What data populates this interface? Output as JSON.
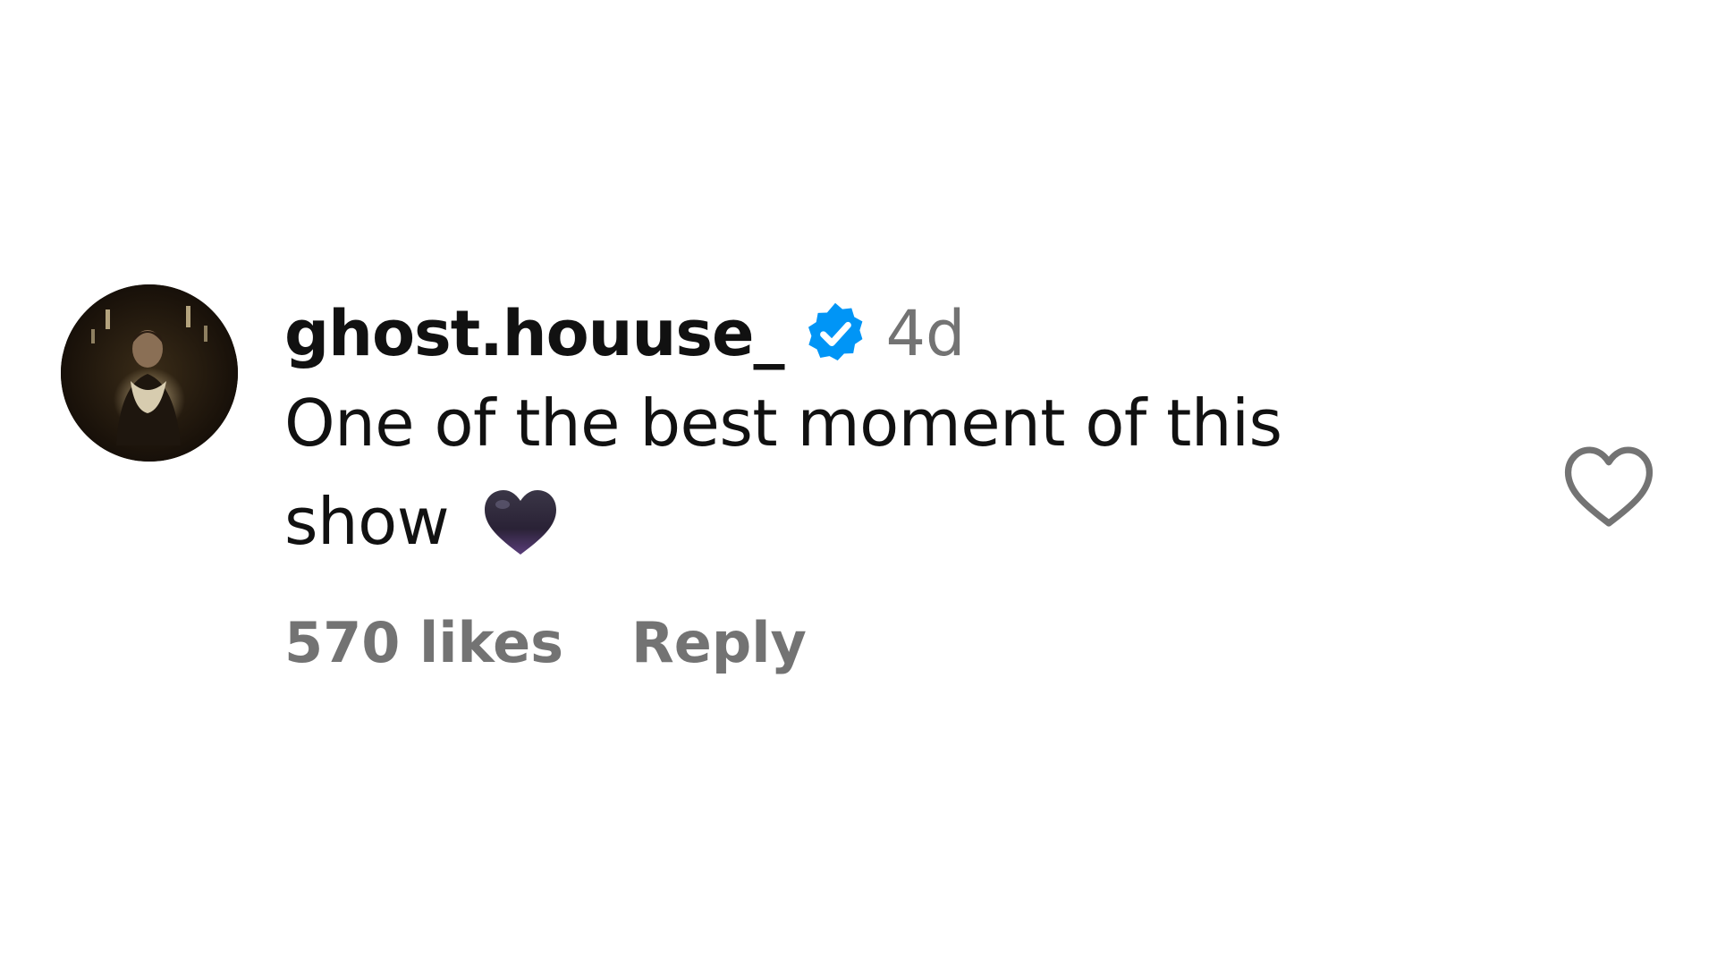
{
  "comment": {
    "username": "ghost.houuse_",
    "verified_icon": "verified-badge-icon",
    "timestamp": "4d",
    "text": "One of the best moment of this show",
    "text_emoji": "black-heart-emoji",
    "likes": "570 likes",
    "reply_label": "Reply",
    "like_icon": "heart-outline-icon"
  },
  "colors": {
    "text": "#111111",
    "muted": "#737373",
    "verified": "#0095f6",
    "background": "#ffffff"
  }
}
